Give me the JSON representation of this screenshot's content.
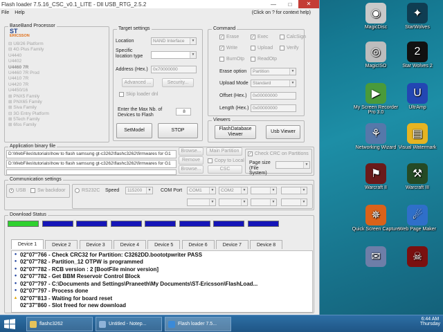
{
  "window": {
    "title": "Flash loader 7.5.16_CSC_v0.1_LITE - Dll USB_RTG_2.5.2",
    "menu": [
      "File",
      "Help"
    ],
    "help_hint": "(Click on ? for context help)"
  },
  "baseband": {
    "legend": "BaseBand Processor",
    "logo_top": "ST",
    "logo_bottom": "ERICSSON",
    "tree": [
      "⊟ U8/26 Platform",
      "⊟ 4G Plus Family",
      "   U4440",
      "   U4402",
      "   U4460 7R",
      "   U4460 7R Prod",
      "   U4410 7R",
      "   U4420 7R",
      "   U4450/16",
      "⊞ PNX5 Family",
      "⊞ PNX65 Family",
      "⊞ Siva Family",
      "⊟ 3G Entry Platform",
      "⊞ 5Tech Family",
      "⊞ 6fos Family"
    ],
    "selected_index": 4
  },
  "target": {
    "legend": "Target settings",
    "location_label": "Location",
    "location_value": "NAND Interface",
    "specific_label": "Specific location type",
    "specific_value": "",
    "address_label": "Address (Hex.)",
    "address_value": "0x70000000",
    "advanced": "Advanced ...",
    "security": "Security...",
    "skip_loader": "Skip loader dnl",
    "max_devices_label": "Enter the Max Nb. of Devices to Flash",
    "max_devices_value": "8",
    "setmodel": "SetModel",
    "stop": "STOP"
  },
  "command": {
    "legend": "Command",
    "erase": "Erase",
    "exec": "Exec",
    "calcsign": "CalcSign",
    "write": "Write",
    "upload": "Upload",
    "verify": "Verify",
    "burnotp": "BurnOtp",
    "readotp": "ReadOtp",
    "erase_option_label": "Erase option",
    "erase_option_value": "Partition",
    "upload_mode_label": "Upload Mode",
    "upload_mode_value": "Standard",
    "offset_label": "Offset (Hex.)",
    "offset_value": "0x00000000",
    "length_label": "Length (Hex.)",
    "length_value": "0x00000000"
  },
  "viewers": {
    "legend": "Viewers",
    "flashdb": "FlashDatabase Viewer",
    "usb": "Usb Viewer"
  },
  "binary": {
    "legend": "Application binary file",
    "path1": "D:\\WebFiles\\tutorials\\how to flash samsung gt-c3262\\flashc3262\\firmwares for G1",
    "path2": "D:\\WebFiles\\tutorials\\how to flash samsung gt-c3262\\flashc3262\\firmwares for G1",
    "path3": "",
    "browse": "Browse...",
    "remove": "Remove",
    "browse2": "Browse...",
    "main_partition": "Main Partition",
    "copy_local": "Copy to Local",
    "csc": "CSC",
    "check_crc": "Check CRC on Partitions",
    "page_size": "Page size (File System)"
  },
  "comm": {
    "legend": "Communication settings",
    "usb": "USB",
    "sw_backdoor": "Sw backdoor",
    "rs232": "RS232C",
    "speed_label": "Speed",
    "speed_value": "115200",
    "com_label": "COM Port",
    "com1": "COM1",
    "com2": "COM2"
  },
  "download": {
    "legend": "Download Status",
    "progress": [
      1,
      0,
      0,
      0,
      0,
      0,
      0,
      0
    ],
    "colors": {
      "done": "#2fd12f",
      "pending": "#1515b8"
    },
    "tabs": [
      "Device 1",
      "Device 2",
      "Device 3",
      "Device 4",
      "Device 5",
      "Device 6",
      "Device 7",
      "Device 8"
    ],
    "log": [
      {
        "icon": "info",
        "text": "02\"07\"766 - Check CRC32 for Partition: C3262DD.boototpwriter PASS"
      },
      {
        "icon": "info",
        "text": "02\"07\"782 - Partition_12 OTPW is programmed"
      },
      {
        "icon": "info",
        "text": "02\"07\"782 - RCB version : 2 [BootFile minor version]"
      },
      {
        "icon": "info",
        "text": "02\"07\"782 - Get BBM Reservoir Control Block"
      },
      {
        "icon": "info",
        "text": "02\"07\"797 - C:\\Documents and Settings\\Praneeth\\My Documents\\ST-Ericsson\\FlashLoad..."
      },
      {
        "icon": "info",
        "text": "02\"07\"797 - Process done"
      },
      {
        "icon": "warn",
        "text": "02\"07\"813 - Waiting for board reset"
      },
      {
        "icon": "blank",
        "text": "02\"37\"860 - Slot freed for new download"
      }
    ]
  },
  "desktop": {
    "icons": [
      {
        "label": "MagicDisc",
        "glyph": "◉",
        "color": "#c9c9c9"
      },
      {
        "label": "StarWolves",
        "glyph": "✦",
        "color": "#0f3d52"
      },
      {
        "label": "MagicISO",
        "glyph": "◎",
        "color": "#bdbdbd"
      },
      {
        "label": "Star Wolves 2",
        "glyph": "2",
        "color": "#111111"
      },
      {
        "label": "My Screen Recorder Pro 3.0",
        "glyph": "▶",
        "color": "#4a9a3a"
      },
      {
        "label": "UltrAmp",
        "glyph": "U",
        "color": "#2346b3"
      },
      {
        "label": "Networking Wizard",
        "glyph": "⚘",
        "color": "#5678aa"
      },
      {
        "label": "Visual Watermark",
        "glyph": "▤",
        "color": "#e6b422"
      },
      {
        "label": "Warcraft II",
        "glyph": "⚑",
        "color": "#6a1a1a"
      },
      {
        "label": "Warcraft III",
        "glyph": "⚒",
        "color": "#254a25"
      },
      {
        "label": "Quick Screen Capture",
        "glyph": "✵",
        "color": "#d9621a"
      },
      {
        "label": "Web Page Maker",
        "glyph": "☄",
        "color": "#2f6fc9"
      },
      {
        "label": "",
        "glyph": "✉",
        "color": "#6e7ea8"
      },
      {
        "label": "",
        "glyph": "☠",
        "color": "#7a1010"
      }
    ]
  },
  "taskbar": {
    "items": [
      "flashc3262",
      "Untitled - Notep...",
      "Flash loader 7.5..."
    ],
    "time": "6:44 AM",
    "day": "Thursday"
  }
}
